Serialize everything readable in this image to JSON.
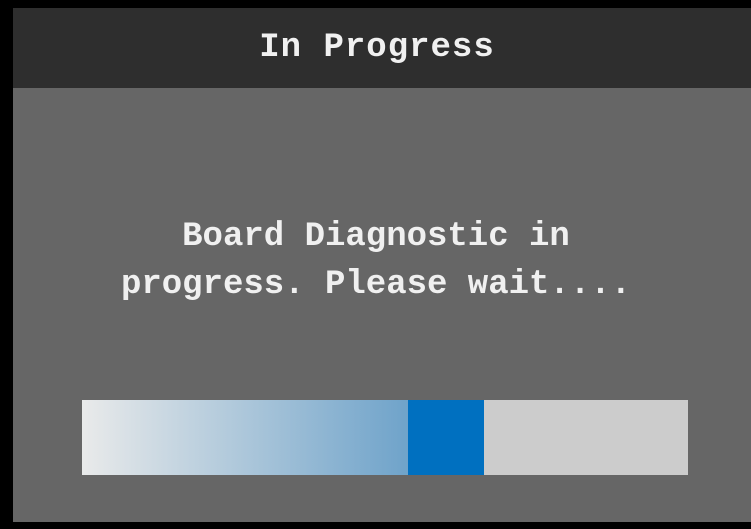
{
  "dialog": {
    "title": "In Progress",
    "message_line1": "Board Diagnostic in",
    "message_line2": "progress. Please wait...."
  },
  "progress": {
    "indeterminate": true,
    "active_block_start_fraction": 0.538,
    "active_block_end_fraction": 0.663,
    "colors": {
      "track": "#cccccc",
      "active_block": "#0070c0",
      "trail_start": "#e9eaea",
      "trail_end": "#6fa3ca"
    }
  },
  "colors": {
    "background": "#666666",
    "titlebar": "#2e2e2e",
    "text": "#f0f0f0",
    "frame": "#000000"
  }
}
